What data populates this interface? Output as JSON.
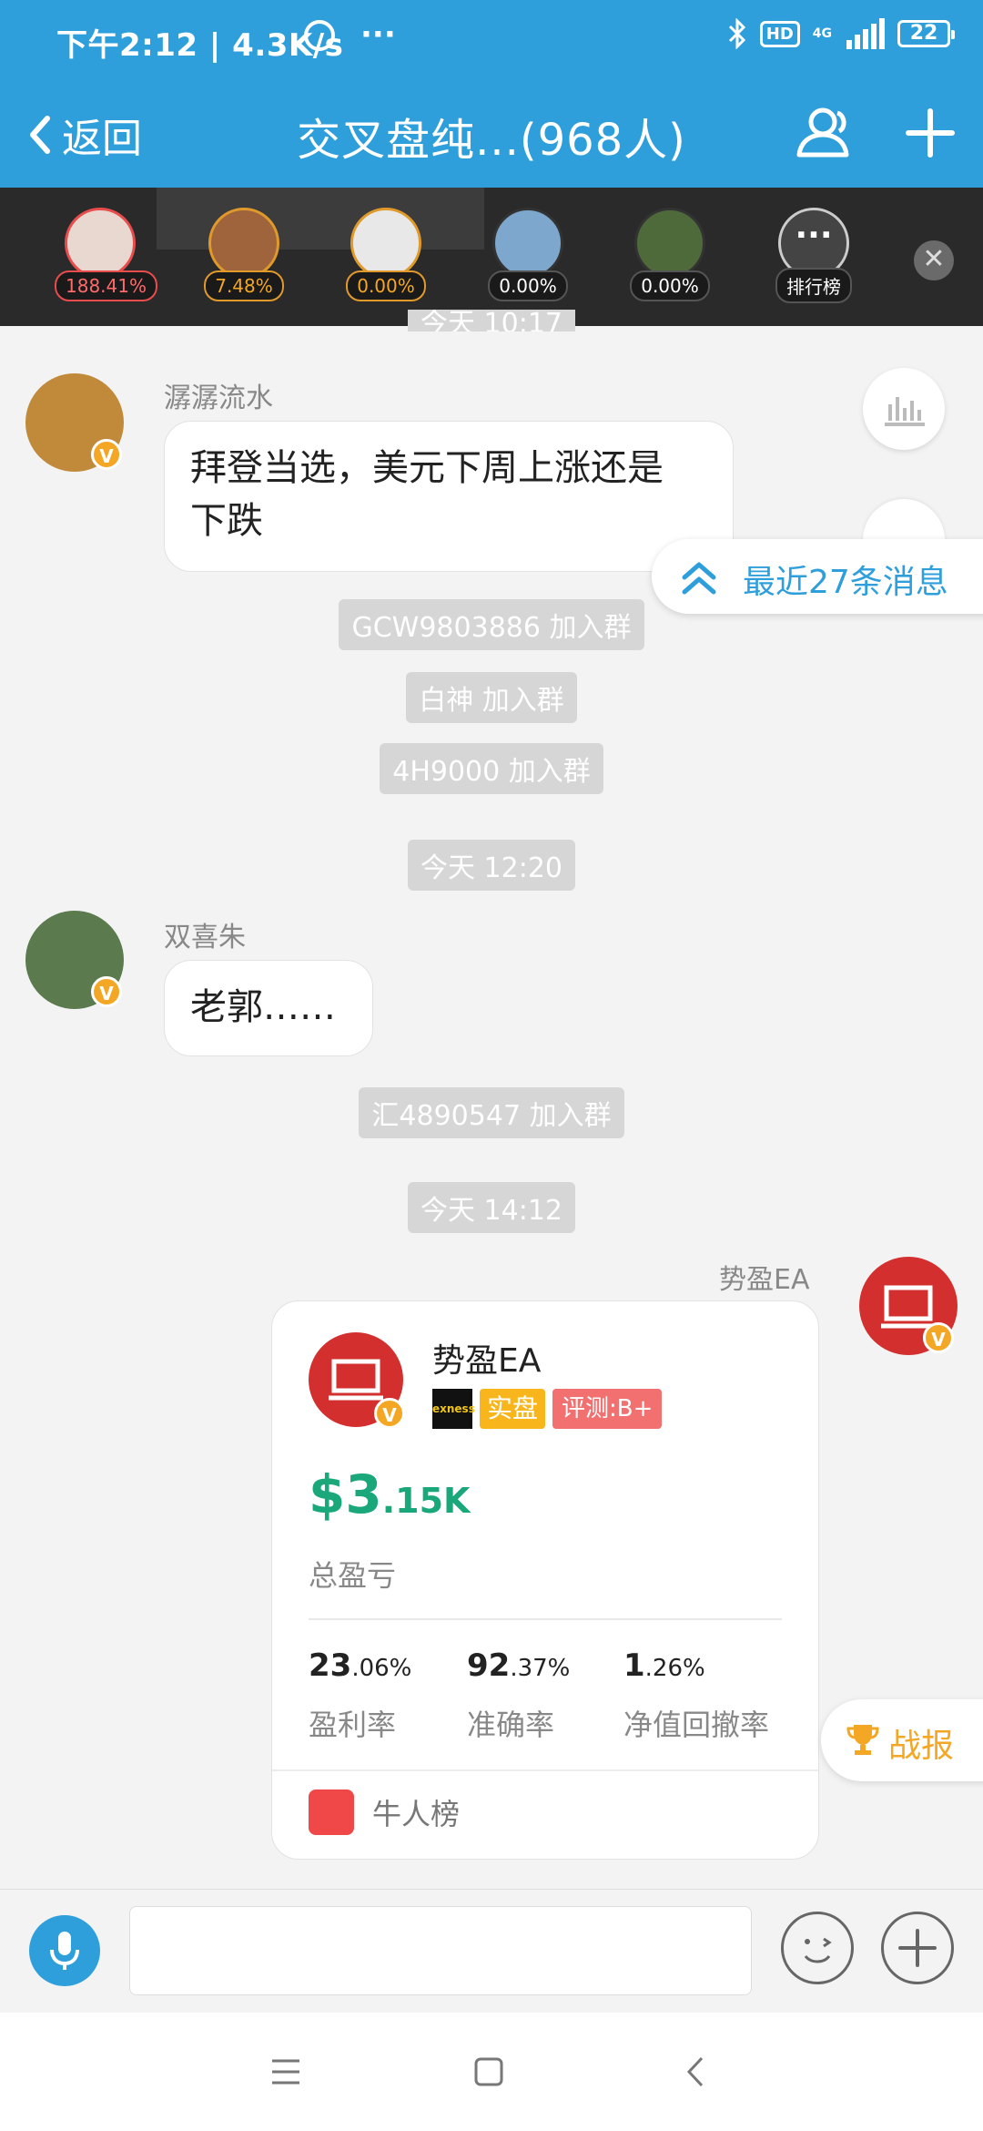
{
  "status_bar": {
    "left_text": "下午2:12 | 4.3K/s",
    "dots": "···",
    "hd": "HD",
    "network": "4G",
    "battery": "22"
  },
  "nav": {
    "back_label": "返回",
    "title": "交叉盘纯...(968人)"
  },
  "ranking": {
    "items": [
      {
        "pct": "188.41%",
        "icon": "avatar-girl"
      },
      {
        "pct": "7.48%",
        "icon": "avatar-cartoon"
      },
      {
        "pct": "0.00%",
        "icon": "avatar-clock"
      },
      {
        "pct": "0.00%",
        "icon": "avatar-einstein"
      },
      {
        "pct": "0.00%",
        "icon": "avatar-plant"
      }
    ],
    "more_label": "排行榜",
    "more_dots": "···",
    "close": "✕"
  },
  "messages": {
    "partial_time": "今天 10:17",
    "msg1_sender": "潺潺流水",
    "msg1_text_line1": "拜登当选，美元下周上涨还是",
    "msg1_text_line2": "下跌",
    "notice1": "GCW9803886 加入群",
    "notice2": "白神 加入群",
    "notice3": "4H9000 加入群",
    "time2": "今天 12:20",
    "msg2_sender": "双喜朱",
    "msg2_text": "老郭……",
    "notice4": "汇4890547 加入群",
    "time3": "今天 14:12",
    "msg3_sender": "势盈EA",
    "verified_mark": "V"
  },
  "recent_btn": "最近27条消息",
  "card": {
    "name": "势盈EA",
    "broker_tag": "exness",
    "live_tag": "实盘",
    "rating_tag": "评测:B+",
    "profit_big": "$3",
    "profit_small": ".15K",
    "profit_label": "总盈亏",
    "stats": [
      {
        "big": "23",
        "small": ".06%",
        "label": "盈利率"
      },
      {
        "big": "92",
        "small": ".37%",
        "label": "准确率"
      },
      {
        "big": "1",
        "small": ".26%",
        "label": "净值回撤率"
      }
    ],
    "footer_label": "牛人榜"
  },
  "zhanbao": "战报",
  "input": {
    "placeholder": ""
  },
  "colors": {
    "primary": "#2f9fdc",
    "badge": "#f4a724",
    "profit": "#1aa87a",
    "danger": "#d32f2f"
  }
}
